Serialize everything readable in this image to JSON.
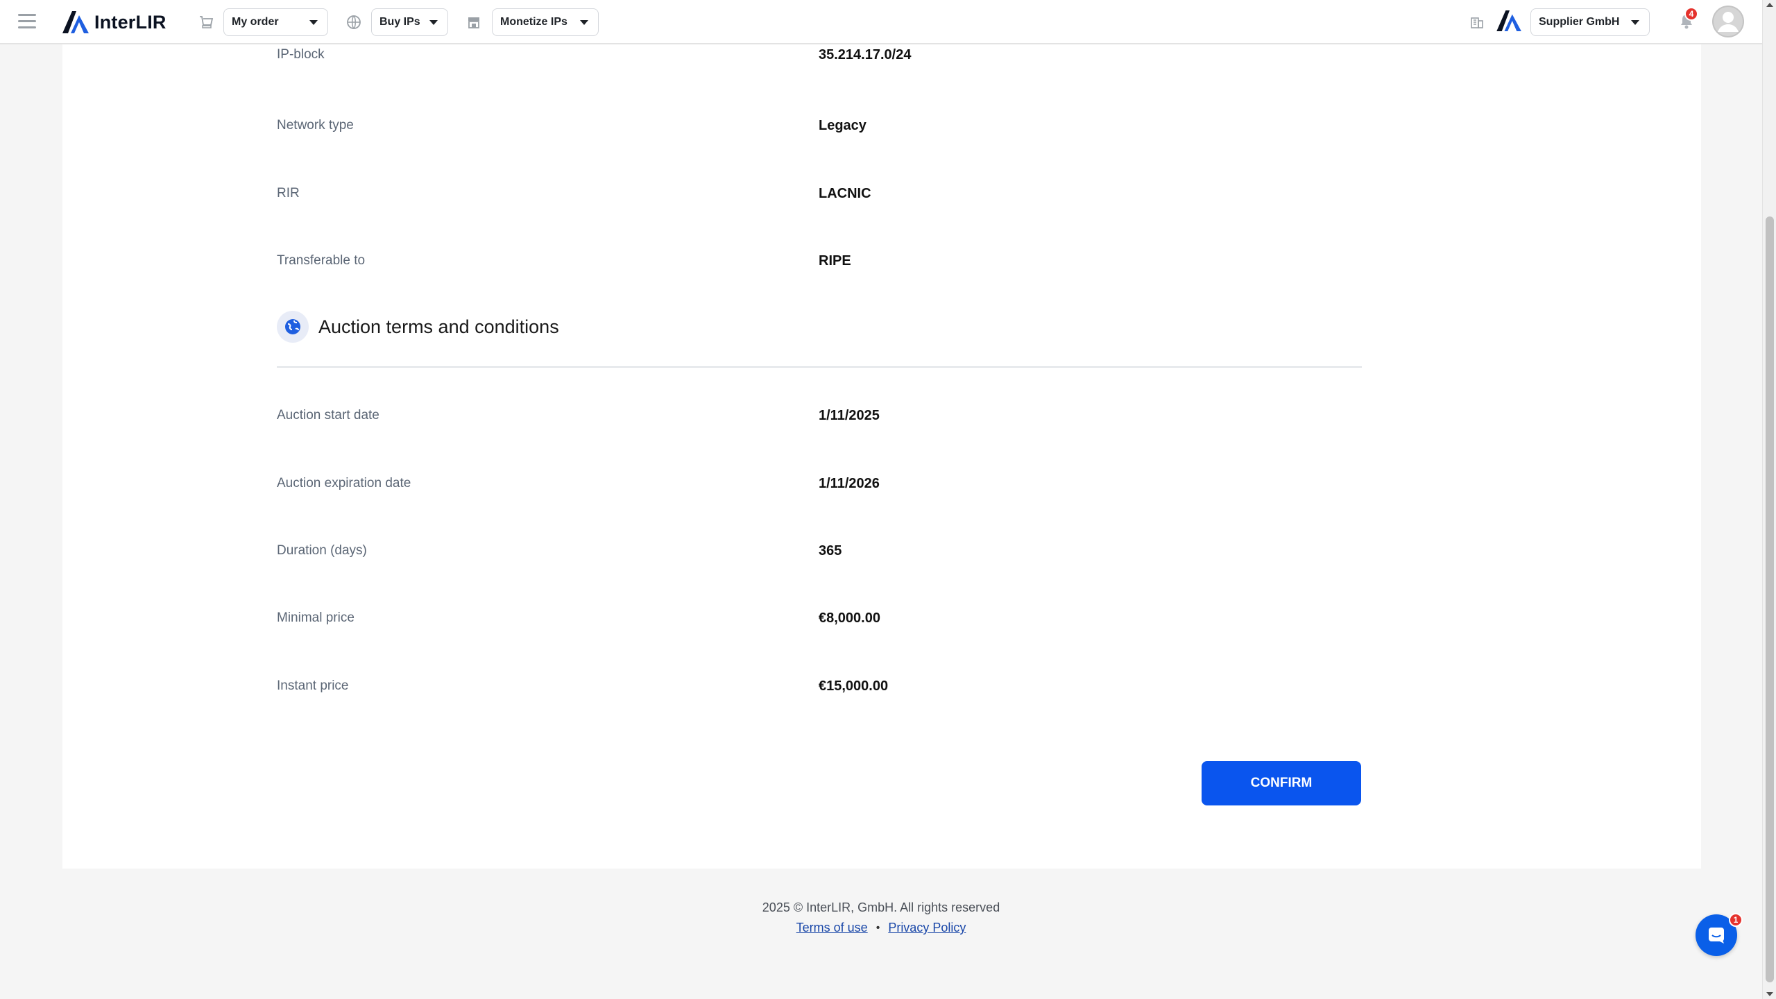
{
  "nav": {
    "brand": "InterLIR",
    "my_order": "My order",
    "buy_ips": "Buy IPs",
    "monetize_ips": "Monetize IPs",
    "company": "Supplier GmbH",
    "notifications_count": "4",
    "icons": {
      "menu": "hamburger-menu-icon",
      "order": "cart-icon",
      "buy": "globe-icon",
      "monetize": "store-icon",
      "company": "building-icon",
      "notifications": "bell-icon",
      "account": "avatar-icon"
    }
  },
  "details": [
    {
      "label": "IP-block",
      "value": "35.214.17.0/24"
    },
    {
      "label": "Network type",
      "value": "Legacy"
    },
    {
      "label": "RIR",
      "value": "LACNIC"
    },
    {
      "label": "Transferable to",
      "value": "RIPE"
    }
  ],
  "auction_section": {
    "title": "Auction terms and conditions",
    "icon": "globe-icon",
    "rows": [
      {
        "label": "Auction start date",
        "value": "1/11/2025"
      },
      {
        "label": "Auction expiration date",
        "value": "1/11/2026"
      },
      {
        "label": "Duration (days)",
        "value": "365"
      },
      {
        "label": "Minimal price",
        "value": "€8,000.00"
      },
      {
        "label": "Instant price",
        "value": "€15,000.00"
      }
    ]
  },
  "actions": {
    "confirm": "CONFIRM"
  },
  "footer": {
    "copyright": "2025 © InterLIR, GmbH. All rights reserved",
    "terms": "Terms of use",
    "separator": "•",
    "privacy": "Privacy Policy"
  },
  "chat": {
    "icon": "chat-icon",
    "unread": "1"
  },
  "colors": {
    "primary": "#0a55ee",
    "badge": "#e5322d",
    "link": "#1846a8",
    "label": "#5b6675"
  }
}
